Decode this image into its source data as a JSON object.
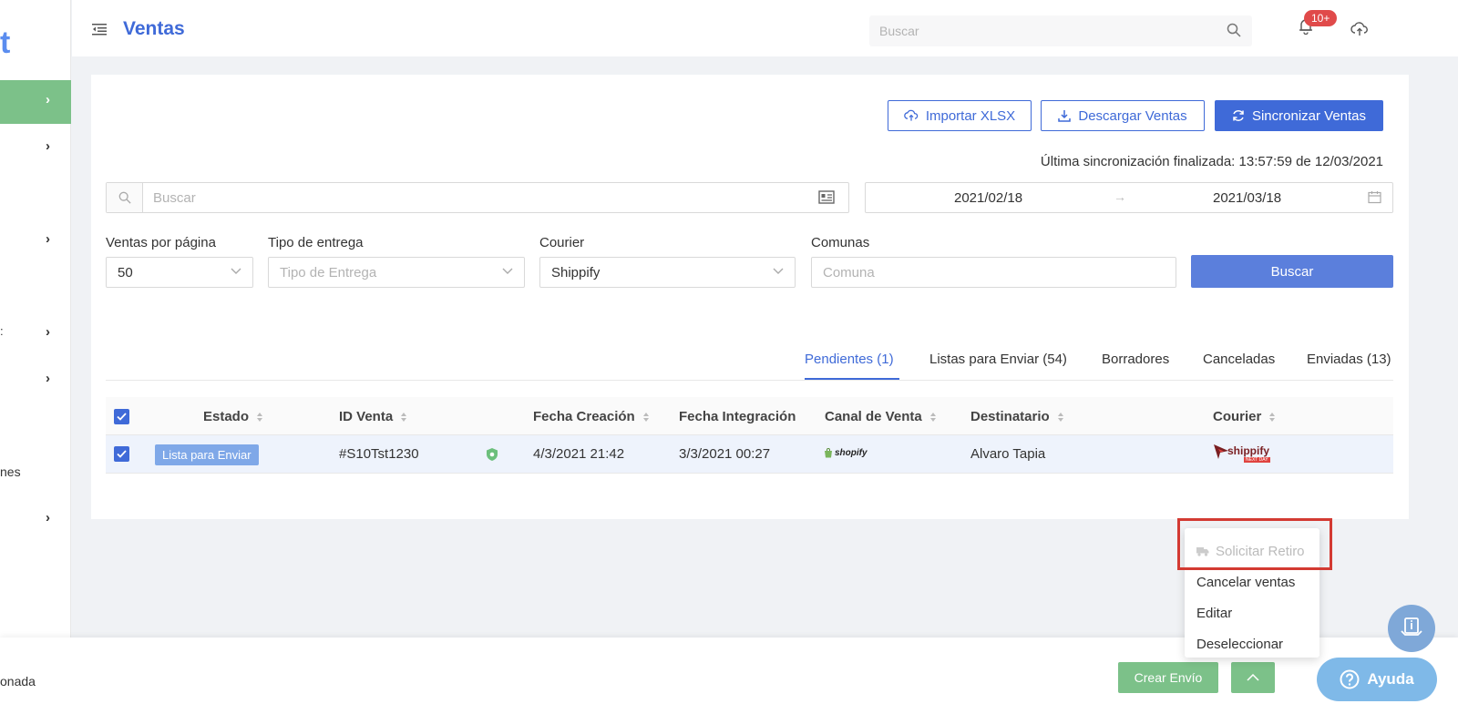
{
  "sidebar": {
    "logo": "t",
    "labels": [
      "nes"
    ]
  },
  "header": {
    "title": "Ventas",
    "search_placeholder": "Buscar",
    "notification_badge": "10+"
  },
  "actions": {
    "import": "Importar XLSX",
    "download": "Descargar Ventas",
    "sync": "Sincronizar Ventas"
  },
  "sync_status": "Última sincronización finalizada: 13:57:59 de 12/03/2021",
  "filters": {
    "search_placeholder": "Buscar",
    "date_from": "2021/02/18",
    "date_to": "2021/03/18",
    "per_page_label": "Ventas por página",
    "per_page_value": "50",
    "delivery_label": "Tipo de entrega",
    "delivery_placeholder": "Tipo de Entrega",
    "courier_label": "Courier",
    "courier_value": "Shippify",
    "comunas_label": "Comunas",
    "comunas_placeholder": "Comuna",
    "search_button": "Buscar"
  },
  "tabs": [
    {
      "label": "Pendientes (1)"
    },
    {
      "label": "Listas para Enviar (54)"
    },
    {
      "label": "Borradores"
    },
    {
      "label": "Canceladas"
    },
    {
      "label": "Enviadas (13)"
    }
  ],
  "table": {
    "columns": [
      "Estado",
      "ID Venta",
      "Fecha Creación",
      "Fecha Integración",
      "Canal de Venta",
      "Destinatario",
      "Courier"
    ],
    "rows": [
      {
        "estado": "Lista para Enviar",
        "id": "#S10Tst1230",
        "fecha_creacion": "4/3/2021 21:42",
        "fecha_integracion": "3/3/2021 00:27",
        "canal": "shopify",
        "destinatario": "Alvaro Tapia",
        "courier": "shippify",
        "courier_sub": "NEXT DAY"
      }
    ]
  },
  "dropdown": {
    "items": [
      "Solicitar Retiro",
      "Cancelar ventas",
      "Editar",
      "Deseleccionar"
    ]
  },
  "bottom": {
    "selection_text": "onada",
    "create_shipment": "Crear Envío",
    "help": "Ayuda"
  },
  "colors": {
    "primary": "#3f6ad8",
    "green": "#7cc189",
    "highlight": "#d33a32"
  }
}
